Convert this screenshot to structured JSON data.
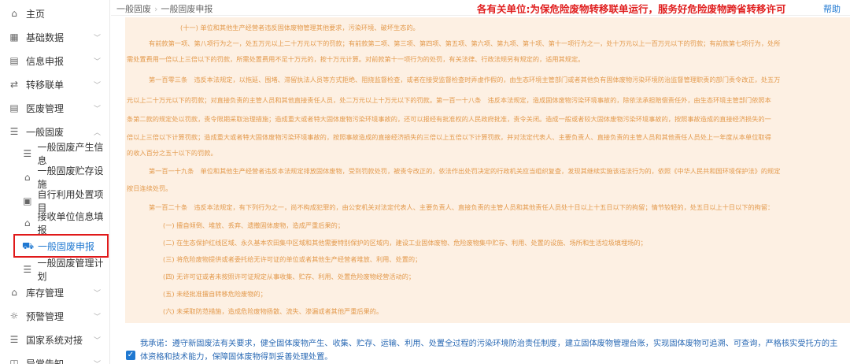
{
  "sidebar": {
    "items": [
      {
        "label": "主页",
        "icon": "home-icon"
      },
      {
        "label": "基础数据",
        "icon": "grid-icon"
      },
      {
        "label": "信息申报",
        "icon": "form-icon"
      },
      {
        "label": "转移联单",
        "icon": "transfer-icon"
      },
      {
        "label": "医废管理",
        "icon": "form-icon"
      },
      {
        "label": "一般固废",
        "icon": "list-icon"
      }
    ],
    "sub_items": [
      {
        "label": "一般固废产生信息",
        "icon": "menu-icon"
      },
      {
        "label": "一般固废贮存设施",
        "icon": "home-icon"
      },
      {
        "label": "自行利用处置项目",
        "icon": "calendar-icon"
      },
      {
        "label": "接收单位信息填报",
        "icon": "home-icon"
      },
      {
        "label": "一般固废申报",
        "icon": "truck-icon"
      },
      {
        "label": "一般固废管理计划",
        "icon": "menu-icon"
      }
    ],
    "bottom_items": [
      {
        "label": "库存管理",
        "icon": "warehouse-icon"
      },
      {
        "label": "预警管理",
        "icon": "alert-icon"
      },
      {
        "label": "国家系统对接",
        "icon": "menu-icon"
      },
      {
        "label": "异常告知",
        "icon": "notice-icon"
      }
    ]
  },
  "breadcrumb": {
    "parent": "一般固废",
    "current": "一般固废申报"
  },
  "notice": "各有关单位:为保危险废物转移联单运行，服务好危险废物跨省转移许可",
  "help": "帮助",
  "legal_text": [
    "(十一) 单位和其他生产经营者违反固体废物管理其他要求，污染环境、破坏生态的。",
    "有前款第一项、第八项行为之一，处五万元以上二十万元以下的罚款；有前款第二项、第三项、第四项、第五项、第六项、第九项、第十项、第十一项行为之一，处十万元以上一百万元以下的罚款；有前款第七项行为，处所",
    "需处置费用一倍以上三倍以下的罚款，所需处置费用不足十万元的，按十万元计算。对前款第十一项行为的处罚，有关法律、行政法规另有规定的，适用其规定。",
    "第一百零三条　违反本法规定，以拖延、围堵、滞留执法人员等方式拒绝、阻挠监督检查，或者在接受监督检查时弄虚作假的，由生态环境主管部门或者其他负有固体废物污染环境防治监督管理职责的部门责令改正，处五万",
    "元以上二十万元以下的罚款；对直接负责的主管人员和其他直接责任人员，处二万元以上十万元以下的罚款。第一百一十八条　违反本法规定，造成固体废物污染环境事故的，除依法承担赔偿责任外，由生态环境主管部门依照本",
    "条第二款的规定处以罚款，责令限期采取治理措施；造成重大或者特大固体废物污染环境事故的，还可以报经有批准权的人民政府批准，责令关闭。造成一般或者较大固体废物污染环境事故的，按照事故造成的直接经济损失的一",
    "倍以上三倍以下计算罚款；造成重大或者特大固体废物污染环境事故的，按照事故造成的直接经济损失的三倍以上五倍以下计算罚款，并对法定代表人、主要负责人、直接负责的主管人员和其他责任人员处上一年度从本单位取得",
    "的收入百分之五十以下的罚款。",
    "第一百一十九条　单位和其他生产经营者违反本法规定排放固体废物，受到罚款处罚，被责令改正的，依法作出处罚决定的行政机关应当组织复查，发现其继续实施该违法行为的，依照《中华人民共和国环境保护法》的规定",
    "按日连续处罚。",
    "第一百二十条　违反本法规定，有下列行为之一，尚不构成犯罪的，由公安机关对法定代表人、主要负责人、直接负责的主管人员和其他责任人员处十日以上十五日以下的拘留；情节较轻的，处五日以上十日以下的拘留：",
    "(一) 擅自倾倒、堆放、丢弃、遗撒固体废物，造成严重后果的；",
    "(二) 在生态保护红线区域、永久基本农田集中区域和其他需要特别保护的区域内，建设工业固体废物、危险废物集中贮存、利用、处置的设施、场所和生活垃圾填埋场的；",
    "(三) 将危险废物提供或者委托给无许可证的单位或者其他生产经营者堆放、利用、处置的；",
    "(四) 无许可证或者未按照许可证规定从事收集、贮存、利用、处置危险废物经营活动的；",
    "(五) 未经批准擅自转移危险废物的；",
    "(六) 未采取防范措施，造成危险废物扬散、流失、渗漏或者其他严重后果的。"
  ],
  "commitment": {
    "line1": "我承诺：遵守新固废法有关要求，健全固体废物产生、收集、贮存、运输、利用、处置全过程的污染环境防治责任制度，建立固体废物管理台账，实现固体废物可追溯、可查询，严格核实受托方的主",
    "line2": "体资格和技术能力，保障固体废物得到妥善处理处置。",
    "checked": true
  },
  "colors": {
    "accent": "#1f78d1",
    "notice": "#e02020",
    "legal_text": "#e39a4d",
    "panel_bg": "#fdf0e3",
    "highlight_box": "#e0191a"
  }
}
